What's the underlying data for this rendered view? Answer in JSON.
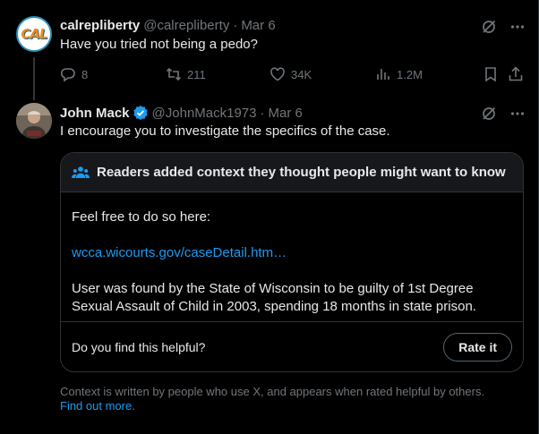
{
  "tweet1": {
    "author_name": "calrepliberty",
    "handle": "@calrepliberty",
    "date": "Mar 6",
    "text": "Have you tried not being a pedo?",
    "avatar_text": "CAL",
    "stats": {
      "replies": "8",
      "reposts": "211",
      "likes": "34K",
      "views": "1.2M"
    }
  },
  "tweet2": {
    "author_name": "John Mack",
    "handle": "@JohnMack1973",
    "date": "Mar 6",
    "text": "I encourage you to investigate the specifics of the case."
  },
  "note": {
    "title": "Readers added context they thought people might want to know",
    "line1": "Feel free to do so here:",
    "link": "wcca.wicourts.gov/caseDetail.htm…",
    "line2a": "User was found by the State of Wisconsin to be guilty of 1st Degree",
    "line2b": "Sexual Assault of Child in 2003, spending 18 months in state prison.",
    "question": "Do you find this helpful?",
    "rate_label": "Rate it"
  },
  "disclaimer": {
    "text": "Context is written by people who use X, and appears when rated helpful by others.",
    "link": "Find out more."
  },
  "colors": {
    "background": "#000000",
    "text": "#e7e9ea",
    "muted": "#71767b",
    "accent": "#1d9bf0",
    "border": "#2f3336",
    "note_header": "#16181c"
  }
}
